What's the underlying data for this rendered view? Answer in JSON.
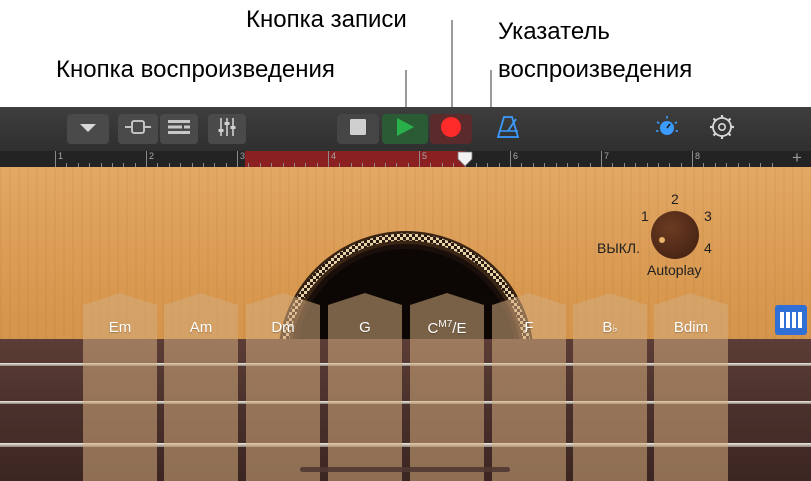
{
  "callouts": {
    "record": "Кнопка записи",
    "play": "Кнопка воспроизведения",
    "playhead_line1": "Указатель",
    "playhead_line2": "воспроизведения"
  },
  "toolbar": {
    "icons": [
      "chevron-down-icon",
      "track-view-icon",
      "tracks-list-icon",
      "mixer-icon",
      "stop-icon",
      "play-icon",
      "record-icon",
      "metronome-icon",
      "master-effects-icon",
      "settings-icon"
    ],
    "colors": {
      "play": "#29b04a",
      "record": "#ff2a2a",
      "accent": "#3b9bff"
    }
  },
  "ruler": {
    "bars": [
      "1",
      "2",
      "3",
      "4",
      "5",
      "6",
      "7",
      "8"
    ],
    "add": "+"
  },
  "autoplay": {
    "label": "Autoplay",
    "off": "ВЫКЛ.",
    "positions": [
      "1",
      "2",
      "3",
      "4"
    ]
  },
  "chords": [
    {
      "label": "Em"
    },
    {
      "label": "Am"
    },
    {
      "label": "Dm"
    },
    {
      "label": "G"
    },
    {
      "label": "C",
      "sup": "M7",
      "suffix": "/E"
    },
    {
      "label": "F"
    },
    {
      "label": "B",
      "suffix": "♭"
    },
    {
      "label": "Bdim"
    }
  ]
}
